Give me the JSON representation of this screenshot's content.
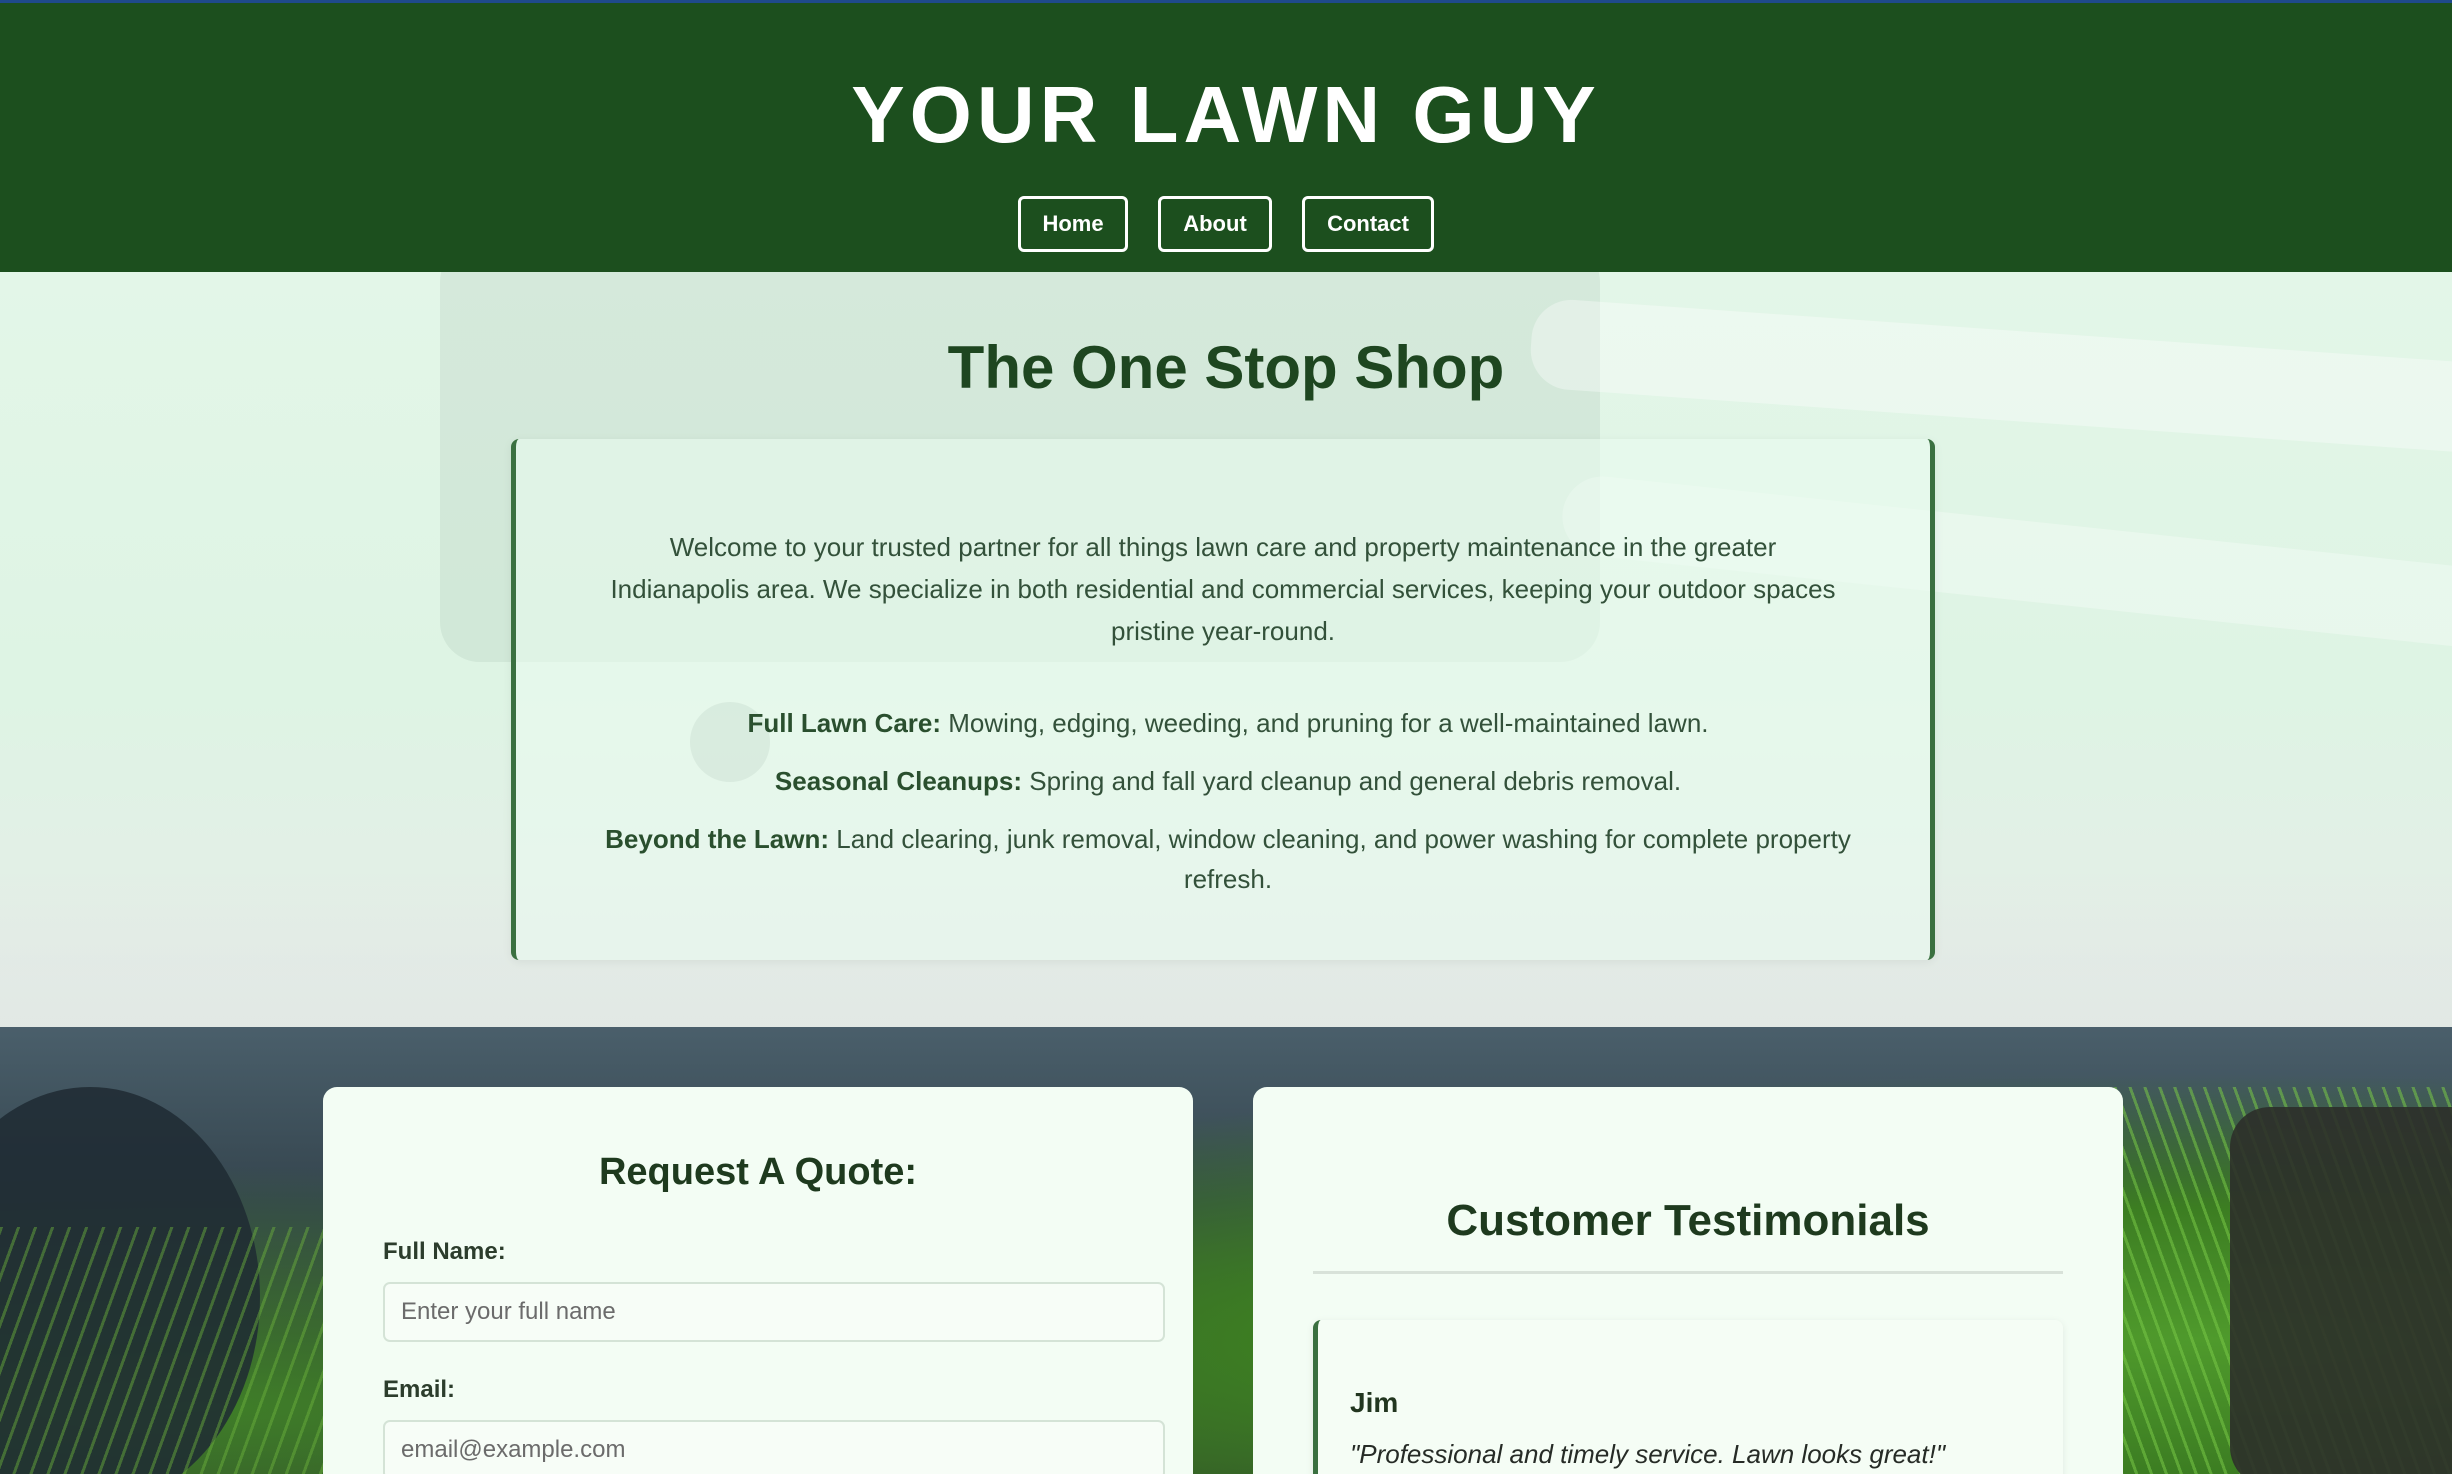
{
  "header": {
    "site_title": "YOUR LAWN GUY",
    "nav": {
      "home_label": "Home",
      "about_label": "About",
      "contact_label": "Contact"
    }
  },
  "hero": {
    "heading": "The One Stop Shop",
    "intro": "Welcome to your trusted partner for all things lawn care and property maintenance in the greater Indianapolis area. We specialize in both residential and commercial services, keeping your outdoor spaces pristine year-round.",
    "services": [
      {
        "title": "Full Lawn Care:",
        "description": " Mowing, edging, weeding, and pruning for a well-maintained lawn."
      },
      {
        "title": "Seasonal Cleanups:",
        "description": " Spring and fall yard cleanup and general debris removal."
      },
      {
        "title": "Beyond the Lawn:",
        "description": " Land clearing, junk removal, window cleaning, and power washing for complete property refresh."
      }
    ]
  },
  "quote_form": {
    "title": "Request A Quote:",
    "full_name_label": "Full Name:",
    "full_name_placeholder": "Enter your full name",
    "email_label": "Email:",
    "email_placeholder": "email@example.com"
  },
  "testimonials": {
    "title": "Customer Testimonials",
    "items": [
      {
        "name": "Jim",
        "text": "\"Professional and timely service. Lawn looks great!\""
      }
    ]
  },
  "colors": {
    "header_bg": "#1c4f1e",
    "accent_green": "#3a7040",
    "heading_green": "#1e4620",
    "panel_bg": "#f3fdf4"
  }
}
